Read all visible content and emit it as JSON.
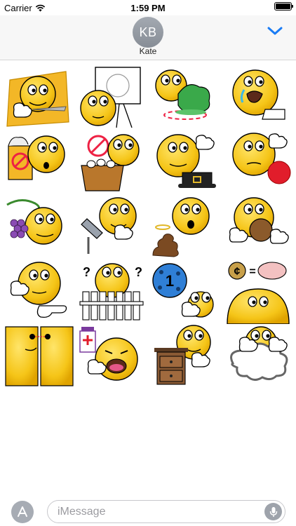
{
  "status_bar": {
    "carrier": "Carrier",
    "time": "1:59 PM",
    "battery_level": 1.0
  },
  "header": {
    "avatar_initials": "KB",
    "contact_name": "Kate",
    "chevron_icon": "chevron-down-icon",
    "accent": "#1a7cf5"
  },
  "stickers": [
    {
      "name": "sticker-knife"
    },
    {
      "name": "sticker-whiteboard"
    },
    {
      "name": "sticker-tree"
    },
    {
      "name": "sticker-crying"
    },
    {
      "name": "sticker-cat-sign"
    },
    {
      "name": "sticker-eggs-basket"
    },
    {
      "name": "sticker-pilgrim-hat"
    },
    {
      "name": "sticker-red-ball"
    },
    {
      "name": "sticker-grapes"
    },
    {
      "name": "sticker-drill"
    },
    {
      "name": "sticker-poop-halo"
    },
    {
      "name": "sticker-cookie"
    },
    {
      "name": "sticker-pointing"
    },
    {
      "name": "sticker-fence-question"
    },
    {
      "name": "sticker-ball-number"
    },
    {
      "name": "sticker-cent-brain"
    },
    {
      "name": "sticker-double-face"
    },
    {
      "name": "sticker-medicine"
    },
    {
      "name": "sticker-nightstand"
    },
    {
      "name": "sticker-cloud-sign"
    }
  ],
  "ball_number": "1",
  "cent_symbol": "¢",
  "equals_symbol": "=",
  "question_marks": "?",
  "bottom_bar": {
    "placeholder": "iMessage",
    "app_icon": "app-store-icon",
    "mic_icon": "microphone-icon"
  }
}
